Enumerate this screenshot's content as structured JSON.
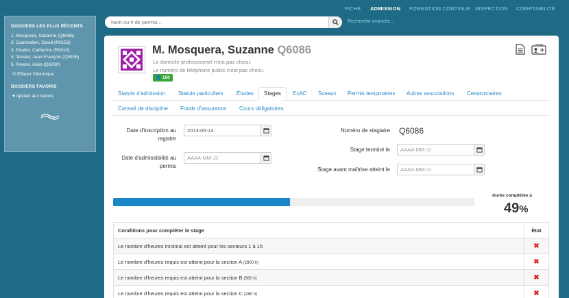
{
  "nav": {
    "items": [
      "FICHE",
      "ADMISSION",
      "FORMATION CONTINUE",
      "INSPECTION",
      "COMPTABILITÉ"
    ],
    "active": "ADMISSION"
  },
  "search": {
    "placeholder": "Nom ou # de permis...",
    "advanced_link": "Recherche avancée..."
  },
  "sidebar": {
    "recent_title": "DOSSIERS LES PLUS RÉCENTS",
    "recent_items": [
      "1. Mosquera, Suzanne (Q6086)",
      "2. Cammalleri, David (R0153)",
      "3. Pouliot, Catherine (R0010)",
      "4. Tessier, Jean-François (Q5926)",
      "5. Rowse, Alain (Q6260)"
    ],
    "clear_history": "Effacer l'historique",
    "favorites_title": "DOSSIERS FAVORIS",
    "add_favorite": "Ajouter aux favoris"
  },
  "header": {
    "name": "M. Mosquera, Suzanne",
    "code": "Q6086",
    "line1": "Le domicile professionnel n'est pas choisi.",
    "line2": "Le numéro de téléphone public n'est pas choisi.",
    "badge": "150"
  },
  "tabs": [
    "Statuts d'admission",
    "Statuts particuliers",
    "Études",
    "Stages",
    "ExAC",
    "Sceaux",
    "Permis temporaires",
    "Autres associations",
    "Cessionnaires",
    "Conseil de discipline",
    "Fonds d'assurance",
    "Cours obligatoires"
  ],
  "active_tab": "Stages",
  "form": {
    "inscription_label": "Date d'inscription au registre",
    "inscription_value": "2013-05-14",
    "admissibilite_label": "Date d'admissibilité au permis",
    "admissibilite_placeholder": "AAAA-MM-JJ",
    "stagiaire_label": "Numéro de stagiaire",
    "stagiaire_value": "Q6086",
    "stage_termine_label": "Stage terminé le",
    "stage_termine_placeholder": "AAAA-MM-JJ",
    "stage_maitrise_label": "Stage avant maîtrise atteint le",
    "stage_maitrise_placeholder": "AAAA-MM-JJ"
  },
  "progress": {
    "label": "durée complétée à",
    "value": 49,
    "number": "49",
    "unit": "%"
  },
  "conditions": {
    "header": "Conditions pour compléter le stage",
    "state_header": "État",
    "rows": [
      {
        "text": "Le nombre d'heures minimal est atteint pour les secteurs 1 à 15",
        "extra": ""
      },
      {
        "text": "Le nombre d'heures requis est atteint pour la section A",
        "extra": "(2800 h)"
      },
      {
        "text": "Le nombre d'heures requis est atteint pour la section B",
        "extra": "(560 h)"
      },
      {
        "text": "Le nombre d'heures requis est atteint pour la section C",
        "extra": "(280 h)"
      }
    ],
    "state_symbol": "✖"
  },
  "colors": {
    "background": "#1f6a85",
    "nav_link": "#8fd3ec",
    "tab_link": "#2a8ac4",
    "progress": "#1a86c8",
    "badge": "#3aa23a",
    "error": "#dd2222"
  }
}
